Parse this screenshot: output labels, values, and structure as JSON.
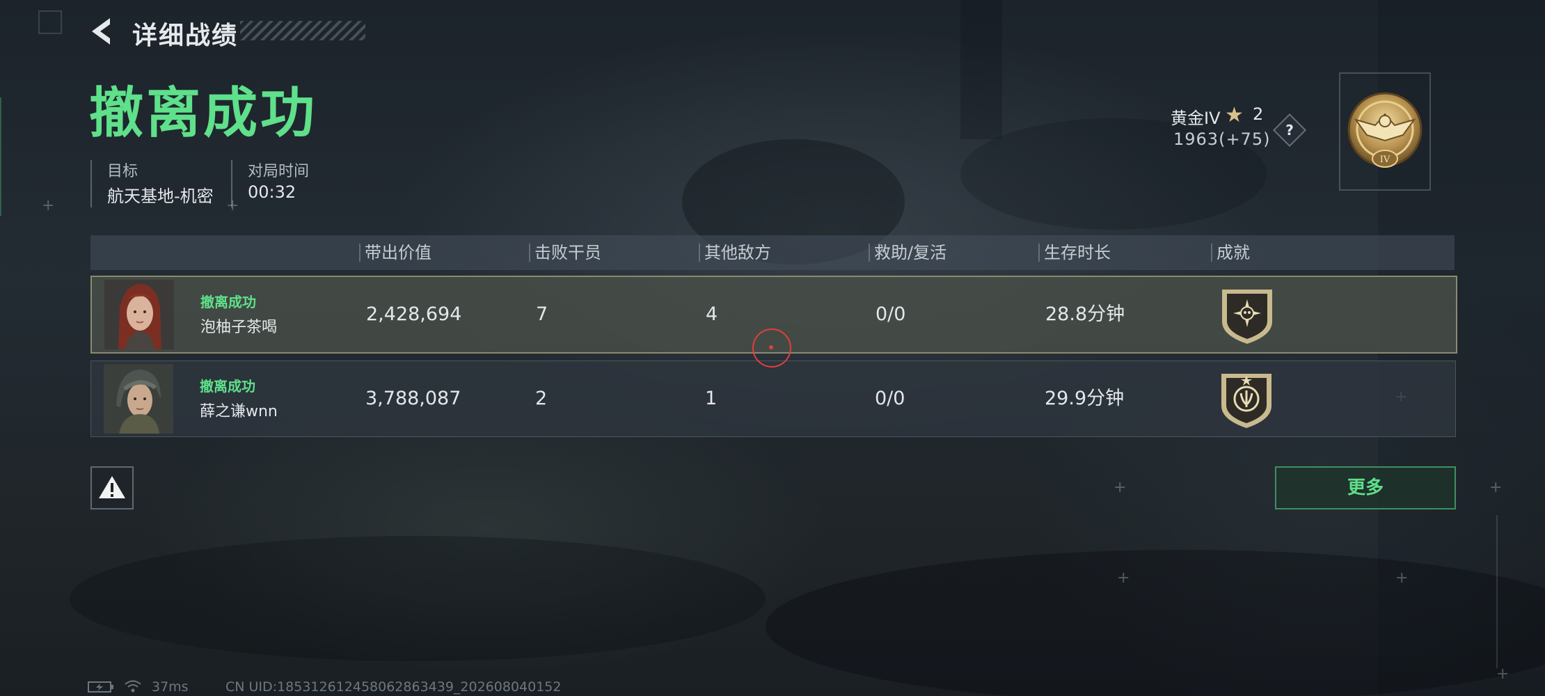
{
  "header": {
    "title": "详细战绩"
  },
  "result": {
    "title": "撤离成功"
  },
  "info": [
    {
      "label": "目标",
      "value": "航天基地-机密"
    },
    {
      "label": "对局时间",
      "value": "00:32"
    }
  ],
  "rank": {
    "name": "黄金IV",
    "stars": "2",
    "score": "1963(+75)",
    "help": "?",
    "badge_numeral": "IV"
  },
  "table": {
    "headers": [
      "带出价值",
      "击败干员",
      "其他敌方",
      "救助/复活",
      "生存时长",
      "成就"
    ],
    "rows": [
      {
        "status": "撤离成功",
        "name": "泡柚子茶喝",
        "value": "2,428,694",
        "kills": "7",
        "others": "4",
        "assist": "0/0",
        "survival": "28.8分钟"
      },
      {
        "status": "撤离成功",
        "name": "薛之谦wnn",
        "value": "3,788,087",
        "kills": "2",
        "others": "1",
        "assist": "0/0",
        "survival": "29.9分钟"
      }
    ]
  },
  "buttons": {
    "more": "更多"
  },
  "footer": {
    "ping": "37ms",
    "uid": "CN UID:185312612458062863439_202608040152"
  },
  "colors": {
    "accent_green": "#5fe08a",
    "pointer_red": "#e0403c"
  }
}
